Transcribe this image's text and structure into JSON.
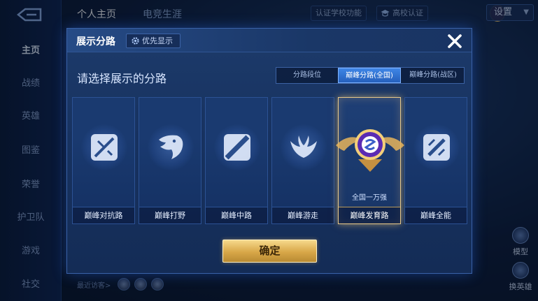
{
  "sidebar": {
    "items": [
      {
        "label": "主页"
      },
      {
        "label": "战绩"
      },
      {
        "label": "英雄"
      },
      {
        "label": "图鉴"
      },
      {
        "label": "荣誉"
      },
      {
        "label": "护卫队"
      },
      {
        "label": "游戏"
      },
      {
        "label": "社交"
      }
    ]
  },
  "topbar": {
    "tabs": [
      {
        "label": "个人主页"
      },
      {
        "label": "电竞生涯"
      }
    ],
    "certify_school": "认证学校功能",
    "campus_cert": "高校认证",
    "settings_label": "设置"
  },
  "bottom": {
    "recent_visitors": "最近访客>"
  },
  "right_controls": [
    {
      "label": "模型"
    },
    {
      "label": "换英雄"
    }
  ],
  "modal": {
    "title": "展示分路",
    "priority_label": "优先显示",
    "prompt": "请选择展示的分路",
    "segments": [
      {
        "label": "分路段位",
        "active": false
      },
      {
        "label": "巅峰分路(全国)",
        "active": true
      },
      {
        "label": "巅峰分路(战区)",
        "active": false
      }
    ],
    "lanes": [
      {
        "label": "巅峰对抗路",
        "icon": "clash-lane-icon",
        "selected": false,
        "rank": ""
      },
      {
        "label": "巅峰打野",
        "icon": "jungle-icon",
        "selected": false,
        "rank": ""
      },
      {
        "label": "巅峰中路",
        "icon": "mid-lane-icon",
        "selected": false,
        "rank": ""
      },
      {
        "label": "巅峰游走",
        "icon": "roam-icon",
        "selected": false,
        "rank": ""
      },
      {
        "label": "巅峰发育路",
        "icon": "farm-lane-icon",
        "selected": true,
        "rank": "全国一万强"
      },
      {
        "label": "巅峰全能",
        "icon": "all-round-icon",
        "selected": false,
        "rank": ""
      }
    ],
    "confirm_label": "确定"
  },
  "colors": {
    "accent_blue": "#3f86e6",
    "gold": "#e8c98a",
    "modal_bg": "#173260"
  }
}
